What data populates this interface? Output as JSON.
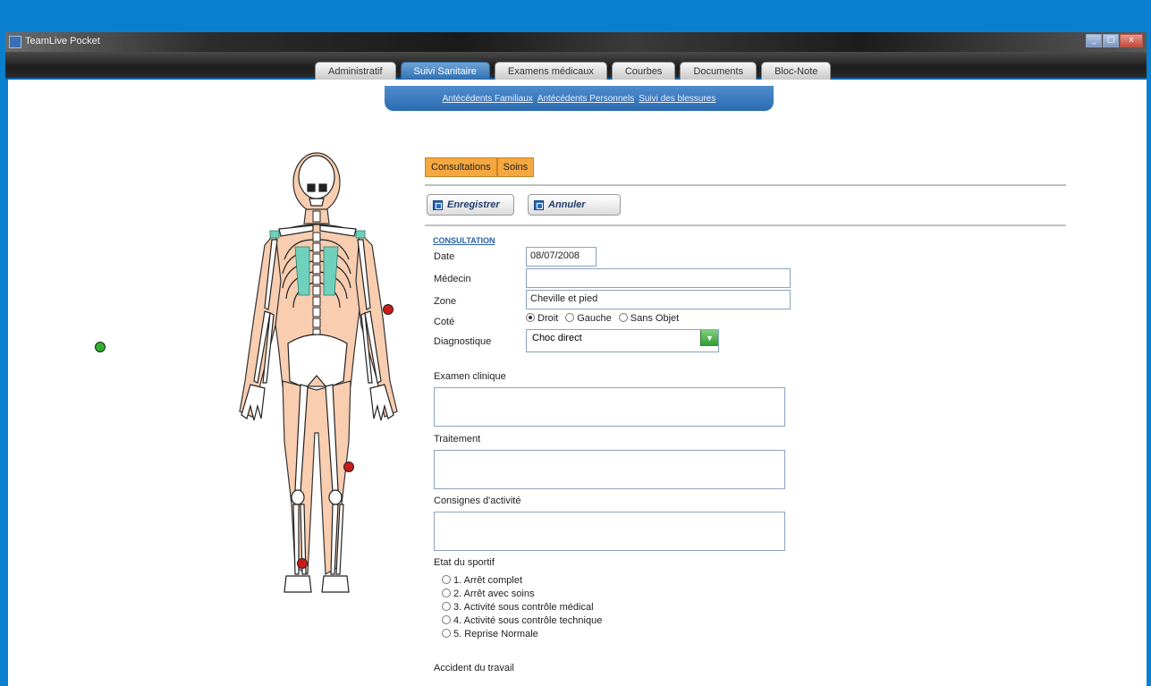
{
  "window": {
    "title": "TeamLive Pocket",
    "controls": {
      "minimize": "_",
      "maximize": "□",
      "close": "x"
    }
  },
  "tabs": [
    {
      "label": "Administratif",
      "active": false
    },
    {
      "label": "Suivi Sanitaire",
      "active": true
    },
    {
      "label": "Examens médicaux",
      "active": false
    },
    {
      "label": "Courbes",
      "active": false
    },
    {
      "label": "Documents",
      "active": false
    },
    {
      "label": "Bloc-Note",
      "active": false
    }
  ],
  "subnav": {
    "links": [
      "Antécédents Familiaux",
      "Antécédents Personnels",
      "Suivi des blessures"
    ]
  },
  "form": {
    "subtabs": [
      "Consultations",
      "Soins"
    ],
    "buttons": {
      "save": "Enregistrer",
      "cancel": "Annuler"
    },
    "section_title": "CONSULTATION",
    "fields": {
      "date_label": "Date",
      "date_value": "08/07/2008",
      "medecin_label": "Médecin",
      "medecin_value": "",
      "zone_label": "Zone",
      "zone_value": "Cheville et pied",
      "cote_label": "Coté",
      "cote_options": [
        "Droit",
        "Gauche",
        "Sans Objet"
      ],
      "cote_selected": "Droit",
      "diagnostique_label": "Diagnostique",
      "diagnostique_value": "Choc direct",
      "examen_label": "Examen clinique",
      "traitement_label": "Traitement",
      "consignes_label": "Consignes d'activité",
      "etat_label": "Etat du sportif",
      "etat_options": [
        "1. Arrêt complet",
        "2. Arrêt avec soins",
        "3. Activité sous contrôle médical",
        "4. Activité sous contrôle technique",
        "5. Reprise Normale"
      ],
      "accident_label": "Accident du travail"
    }
  },
  "colors": {
    "desktop": "#0a7fd0",
    "subtab_orange": "#f5a840",
    "injury_marker": "#cc1a1a",
    "status_marker": "#2fb02f"
  }
}
